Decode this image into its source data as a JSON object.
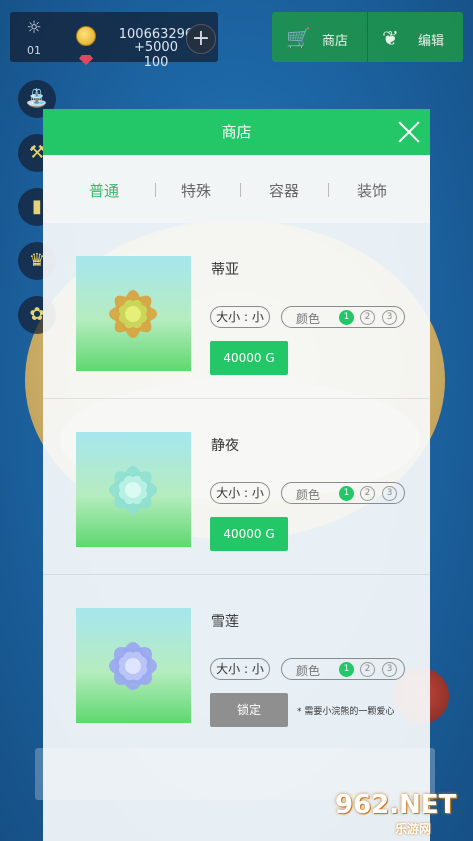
{
  "hud": {
    "level": "01",
    "coins": "100663296",
    "coin_bonus": "+5000",
    "gems": "100"
  },
  "top_buttons": {
    "shop_label": "商店",
    "edit_label": "编辑"
  },
  "side_buttons": [
    "watering-can",
    "shovel",
    "book",
    "trophy",
    "plant-pot"
  ],
  "modal": {
    "title": "商店",
    "tabs": [
      {
        "label": "普通",
        "active": true
      },
      {
        "label": "特殊",
        "active": false
      },
      {
        "label": "容器",
        "active": false
      },
      {
        "label": "装饰",
        "active": false
      }
    ],
    "items": [
      {
        "name": "蒂亚",
        "size_label": "大小 : 小",
        "color_label": "颜色",
        "color_options": [
          "1",
          "2",
          "3"
        ],
        "selected_color": "1",
        "price": "40000 G",
        "locked": false,
        "flower_colors": {
          "outer": "#d9a23c",
          "inner": "#c9d65a",
          "core": "#e7ef7b"
        }
      },
      {
        "name": "静夜",
        "size_label": "大小 : 小",
        "color_label": "颜色",
        "color_options": [
          "1",
          "2",
          "3"
        ],
        "selected_color": "1",
        "price": "40000 G",
        "locked": false,
        "flower_colors": {
          "outer": "#8fe0d0",
          "inner": "#b8f0e4",
          "core": "#d9fbf2"
        }
      },
      {
        "name": "雪莲",
        "size_label": "大小 : 小",
        "color_label": "颜色",
        "color_options": [
          "1",
          "2",
          "3"
        ],
        "selected_color": "1",
        "locked": true,
        "lock_label": "锁定",
        "lock_note": "* 需要小浣熊的一颗爱心",
        "flower_colors": {
          "outer": "#9aa6f2",
          "inner": "#b9c4f7",
          "core": "#dfe4ff"
        }
      }
    ]
  },
  "watermark": {
    "brand": "962.NET",
    "subtitle": "乐游网"
  },
  "colors": {
    "accent_green": "#23c767",
    "tab_active": "#34b96a",
    "locked_gray": "#8f8f8f"
  }
}
